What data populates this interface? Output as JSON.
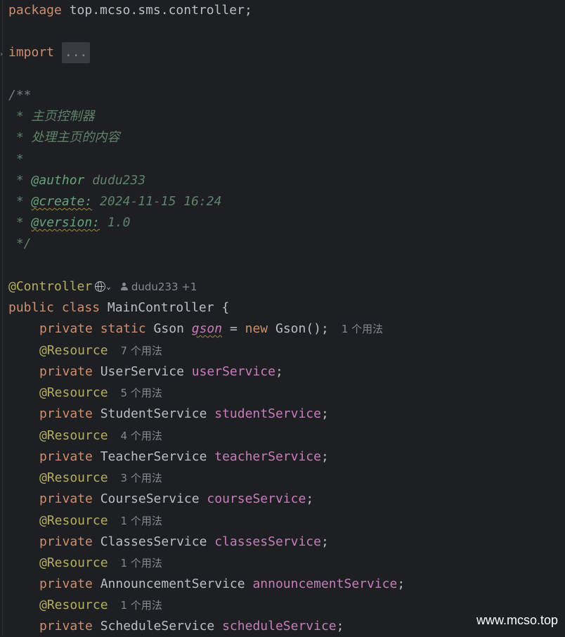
{
  "code": {
    "package_kw": "package",
    "package_name": " top.mcso.sms.controller;",
    "import_kw": "import",
    "import_fold": "...",
    "doc_open": "/**",
    "doc_line1": " * 主页控制器",
    "doc_line2": " * 处理主页的内容",
    "doc_line3": " *",
    "doc_author_prefix": " * ",
    "doc_author_tag": "@author",
    "doc_author_value": " dudu233",
    "doc_create_prefix": " * ",
    "doc_create_tag": "@create:",
    "doc_create_value": " 2024-11-15 16:24",
    "doc_version_prefix": " * ",
    "doc_version_tag": "@version:",
    "doc_version_value": " 1.0",
    "doc_close": " */",
    "controller_annotation": "@Controller",
    "author_hint": "dudu233 +1",
    "class_decl_kw": "public class",
    "class_name": " MainController {",
    "gson_line": {
      "private_kw": "private",
      "static_kw": " static",
      "type": " Gson ",
      "field": "gson",
      "assign": " = ",
      "new_kw": "new",
      "init": " Gson();",
      "usages": "1 个用法"
    },
    "fields": [
      {
        "annotation": "@Resource",
        "usages": "7 个用法",
        "private_kw": "private",
        "type": " UserService ",
        "name": "userService",
        "semi": ";"
      },
      {
        "annotation": "@Resource",
        "usages": "5 个用法",
        "private_kw": "private",
        "type": " StudentService ",
        "name": "studentService",
        "semi": ";"
      },
      {
        "annotation": "@Resource",
        "usages": "4 个用法",
        "private_kw": "private",
        "type": " TeacherService ",
        "name": "teacherService",
        "semi": ";"
      },
      {
        "annotation": "@Resource",
        "usages": "3 个用法",
        "private_kw": "private",
        "type": " CourseService ",
        "name": "courseService",
        "semi": ";"
      },
      {
        "annotation": "@Resource",
        "usages": "1 个用法",
        "private_kw": "private",
        "type": " ClassesService ",
        "name": "classesService",
        "semi": ";"
      },
      {
        "annotation": "@Resource",
        "usages": "1 个用法",
        "private_kw": "private",
        "type": " AnnouncementService ",
        "name": "announcementService",
        "semi": ";"
      },
      {
        "annotation": "@Resource",
        "usages": "1 个用法",
        "private_kw": "private",
        "type": " ScheduleService ",
        "name": "scheduleService",
        "semi": ";"
      }
    ]
  },
  "watermark": "www.mcso.top",
  "colors": {
    "background": "#1e1f22",
    "keyword": "#cf8e6d",
    "annotation": "#b3ae60",
    "field": "#c77dbb",
    "doc_comment": "#5f826b",
    "hint": "#868991"
  }
}
